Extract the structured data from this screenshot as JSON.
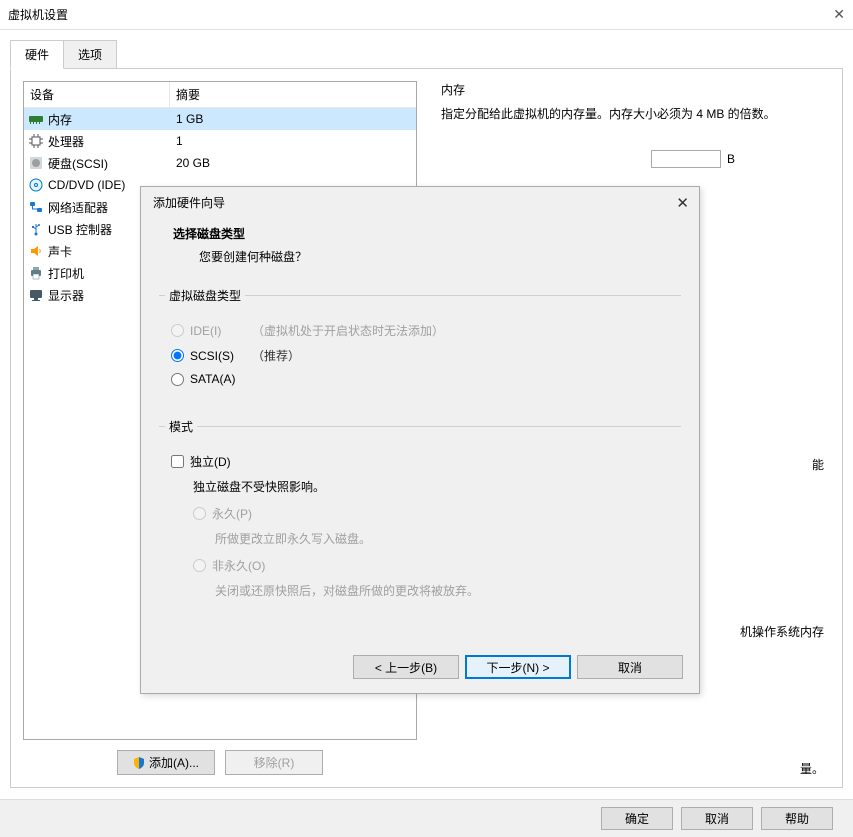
{
  "window": {
    "title": "虚拟机设置"
  },
  "tabs": {
    "hardware": "硬件",
    "options": "选项"
  },
  "device_table": {
    "col_device": "设备",
    "col_summary": "摘要",
    "rows": [
      {
        "name": "内存",
        "summary": "1 GB",
        "icon": "memory"
      },
      {
        "name": "处理器",
        "summary": "1",
        "icon": "cpu"
      },
      {
        "name": "硬盘(SCSI)",
        "summary": "20 GB",
        "icon": "disk"
      },
      {
        "name": "CD/DVD (IDE)",
        "summary": "",
        "icon": "cd"
      },
      {
        "name": "网络适配器",
        "summary": "",
        "icon": "net"
      },
      {
        "name": "USB 控制器",
        "summary": "",
        "icon": "usb"
      },
      {
        "name": "声卡",
        "summary": "",
        "icon": "sound"
      },
      {
        "name": "打印机",
        "summary": "",
        "icon": "print"
      },
      {
        "name": "显示器",
        "summary": "",
        "icon": "display"
      }
    ]
  },
  "right_panel": {
    "heading": "内存",
    "text": "指定分配给此虚拟机的内存量。内存大小必须为 4 MB 的倍数。",
    "partial_unit": "B",
    "lower1": "能",
    "lower2": "机操作系统内存",
    "lower3": "量。"
  },
  "hw_buttons": {
    "add": "添加(A)...",
    "remove": "移除(R)"
  },
  "footer": {
    "ok": "确定",
    "cancel": "取消",
    "help": "帮助"
  },
  "wizard": {
    "title": "添加硬件向导",
    "header_title": "选择磁盘类型",
    "header_sub": "您要创建何种磁盘？",
    "group_disktype": "虚拟磁盘类型",
    "opt_ide": "IDE(I)",
    "opt_ide_hint": "（虚拟机处于开启状态时无法添加）",
    "opt_scsi": "SCSI(S)",
    "opt_scsi_hint": "（推荐）",
    "opt_sata": "SATA(A)",
    "group_mode": "模式",
    "chk_independent": "独立(D)",
    "independent_desc": "独立磁盘不受快照影响。",
    "opt_persistent": "永久(P)",
    "persistent_desc": "所做更改立即永久写入磁盘。",
    "opt_nonpersistent": "非永久(O)",
    "nonpersistent_desc": "关闭或还原快照后，对磁盘所做的更改将被放弃。",
    "btn_back": "< 上一步(B)",
    "btn_next": "下一步(N) >",
    "btn_cancel": "取消"
  }
}
